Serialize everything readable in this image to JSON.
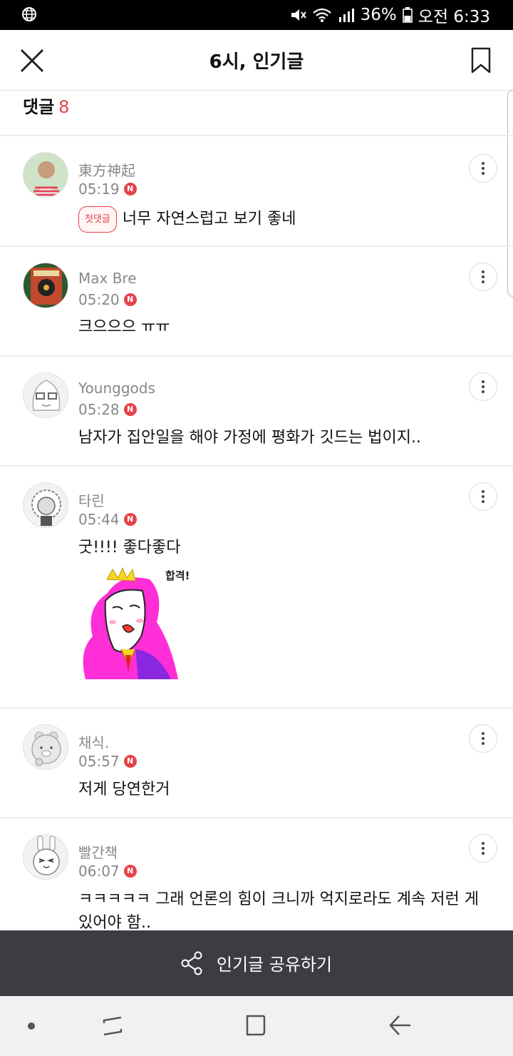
{
  "status_bar": {
    "battery": "36%",
    "time": "오전 6:33"
  },
  "header": {
    "title": "6시, 인기글"
  },
  "comments_header": {
    "label": "댓글",
    "count": "8"
  },
  "comments": [
    {
      "author": "東方神起",
      "time": "05:19",
      "new_badge": "N",
      "first_badge": "첫댓글",
      "text": "너무 자연스럽고 보기 좋네"
    },
    {
      "author": "Max Bre",
      "time": "05:20",
      "new_badge": "N",
      "text": "크으으으 ㅠㅠ"
    },
    {
      "author": "Younggods",
      "time": "05:28",
      "new_badge": "N",
      "text": "남자가 집안일을 해야 가정에 평화가 깃드는 법이지.."
    },
    {
      "author": "타린",
      "time": "05:44",
      "new_badge": "N",
      "text": "굿!!!! 좋다좋다",
      "sticker_caption": "합격!"
    },
    {
      "author": "채식.",
      "time": "05:57",
      "new_badge": "N",
      "text": "저게 당연한거"
    },
    {
      "author": "빨간책",
      "time": "06:07",
      "new_badge": "N",
      "text": "ㅋㅋㅋㅋㅋ 그래 언론의 힘이 크니까 억지로라도 계속 저런 게 있어야 함.."
    }
  ],
  "share_bar": {
    "label": "인기글 공유하기"
  },
  "colors": {
    "accent": "#e5434a",
    "share_bg": "#3b3d42"
  }
}
